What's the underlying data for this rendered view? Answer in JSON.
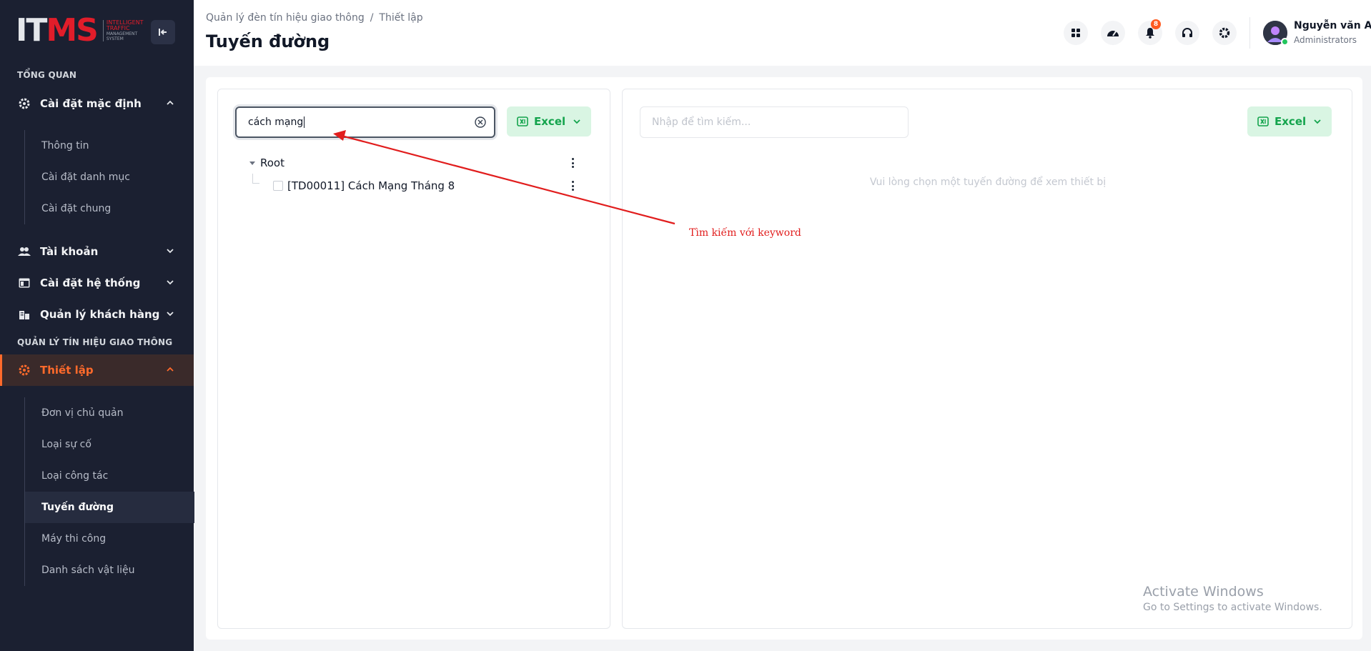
{
  "logo": {
    "mark_a": "IT",
    "mark_b": "MS",
    "sub1": "INTELLIGENT",
    "sub2": "TRAFFIC",
    "sub3": "MANAGEMENT",
    "sub4": "SYSTEM"
  },
  "sidebar": {
    "section_overview": "TỔNG QUAN",
    "section_traffic": "QUẢN LÝ TÍN HIỆU GIAO THÔNG",
    "menu_default_settings": "Cài đặt mặc định",
    "default_sub": [
      "Thông tin",
      "Cài đặt danh mục",
      "Cài đặt chung"
    ],
    "menu_accounts": "Tài khoản",
    "menu_system_settings": "Cài đặt hệ thống",
    "menu_customers": "Quản lý khách hàng",
    "menu_setup": "Thiết lập",
    "setup_sub": [
      "Đơn vị chủ quản",
      "Loại sự cố",
      "Loại công tác",
      "Tuyến đường",
      "Máy thi công",
      "Danh sách vật liệu"
    ]
  },
  "header": {
    "breadcrumb_1": "Quản lý đèn tín hiệu giao thông",
    "breadcrumb_sep": "/",
    "breadcrumb_2": "Thiết lập",
    "title": "Tuyến đường",
    "notification_count": "8",
    "user_name": "Nguyễn văn A",
    "user_role": "Administrators"
  },
  "left_panel": {
    "search_value": "cách mạng",
    "excel_label": "Excel",
    "tree_root": "Root",
    "tree_child": "[TD00011] Cách Mạng Tháng 8"
  },
  "right_panel": {
    "search_placeholder": "Nhập để tìm kiếm...",
    "excel_label": "Excel",
    "empty_message": "Vui lòng chọn một tuyến đường để xem thiết bị"
  },
  "annotation": {
    "text": "Tìm kiếm với keyword",
    "color": "#e11d1d"
  },
  "watermark": {
    "line1": "Activate Windows",
    "line2": "Go to Settings to activate Windows."
  },
  "colors": {
    "sidebar_bg": "#1b2031",
    "accent": "#ff6a2b",
    "excel_green": "#14a44d",
    "excel_bg": "#d9f5e3"
  }
}
